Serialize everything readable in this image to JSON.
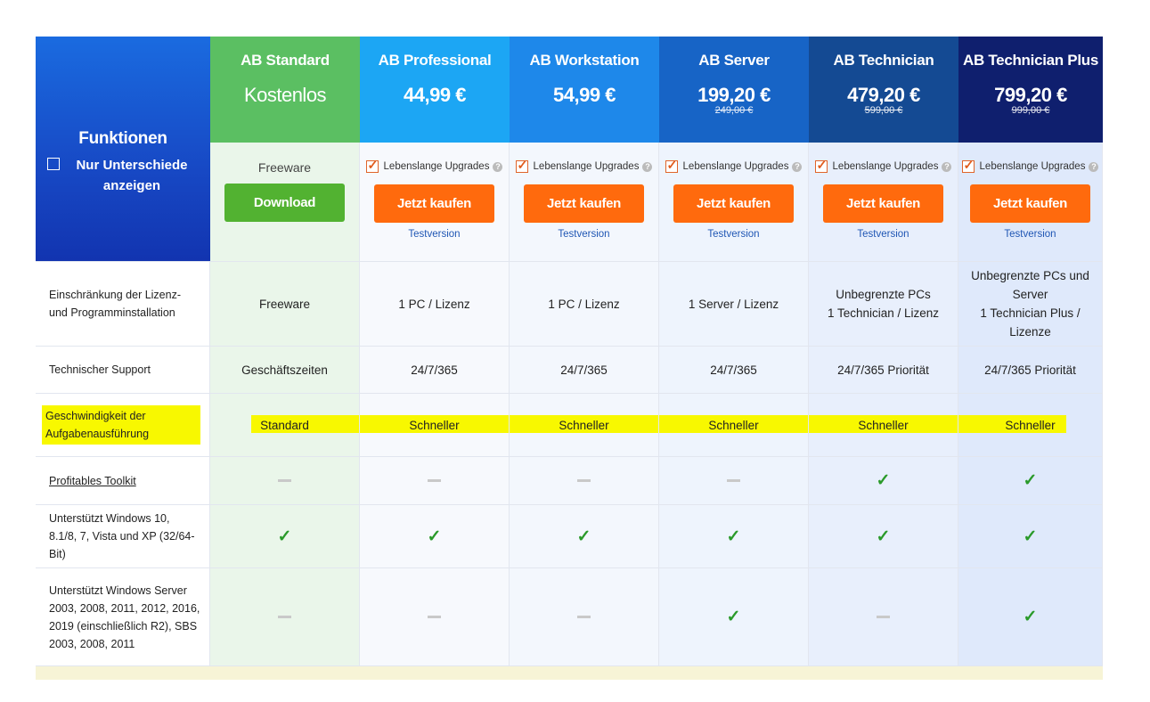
{
  "features_header": {
    "title": "Funktionen",
    "only_diff": "Nur Unterschiede anzeigen"
  },
  "plans": [
    {
      "name": "AB Standard",
      "price": "Kostenlos",
      "old_price": "",
      "color": "#5bbf62",
      "sub_text": "Freeware",
      "button": "Download",
      "trial": ""
    },
    {
      "name": "AB Professional",
      "price": "44,99 €",
      "old_price": "",
      "color": "#1ca6f4",
      "upgrade": "Lebenslange Upgrades",
      "button": "Jetzt kaufen",
      "trial": "Testversion"
    },
    {
      "name": "AB Workstation",
      "price": "54,99 €",
      "old_price": "",
      "color": "#1e88ea",
      "upgrade": "Lebenslange Upgrades",
      "button": "Jetzt kaufen",
      "trial": "Testversion"
    },
    {
      "name": "AB Server",
      "price": "199,20 €",
      "old_price": "249,00 €",
      "color": "#1764c6",
      "upgrade": "Lebenslange Upgrades",
      "button": "Jetzt kaufen",
      "trial": "Testversion"
    },
    {
      "name": "AB Technician",
      "price": "479,20 €",
      "old_price": "599,00 €",
      "color": "#144a93",
      "upgrade": "Lebenslange Upgrades",
      "button": "Jetzt kaufen",
      "trial": "Testversion"
    },
    {
      "name": "AB Technician Plus",
      "price": "799,20 €",
      "old_price": "999,00 €",
      "color": "#0f1f6e",
      "upgrade": "Lebenslange Upgrades",
      "button": "Jetzt kaufen",
      "trial": "Testversion"
    }
  ],
  "rows": [
    {
      "label": "Einschränkung der Lizenz- und Programminstallation",
      "values": [
        "Freeware",
        "1 PC / Lizenz",
        "1 PC / Lizenz",
        "1 Server / Lizenz",
        "Unbegrenzte PCs\n1 Technician / Lizenz",
        "Unbegrenzte PCs und Server\n1 Technician Plus / Lizenze"
      ]
    },
    {
      "label": "Technischer Support",
      "values": [
        "Geschäftszeiten",
        "24/7/365",
        "24/7/365",
        "24/7/365",
        "24/7/365 Priorität",
        "24/7/365 Priorität"
      ]
    },
    {
      "label": "Geschwindigkeit der Aufgabenausführung",
      "values": [
        "Standard",
        "Schneller",
        "Schneller",
        "Schneller",
        "Schneller",
        "Schneller"
      ]
    },
    {
      "label": "Profitables Toolkit",
      "values": [
        "dash",
        "dash",
        "dash",
        "dash",
        "check",
        "check"
      ]
    },
    {
      "label": "Unterstützt Windows 10, 8.1/8, 7, Vista und XP (32/64-Bit)",
      "values": [
        "check",
        "check",
        "check",
        "check",
        "check",
        "check"
      ]
    },
    {
      "label": "Unterstützt Windows Server 2003, 2008, 2011, 2012, 2016, 2019 (einschließlich R2), SBS 2003, 2008, 2011",
      "values": [
        "dash",
        "dash",
        "dash",
        "check",
        "dash",
        "check"
      ]
    }
  ],
  "icons": {
    "check": "check-icon",
    "dash": "dash-icon",
    "question": "question-icon"
  }
}
